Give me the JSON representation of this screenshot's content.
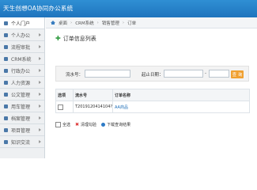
{
  "app": {
    "title": "天生创想OA协同办公系统"
  },
  "sidebar": {
    "items": [
      {
        "label": "个人门户",
        "icon": "home-icon",
        "active": true
      },
      {
        "label": "个人办公",
        "icon": "person-icon"
      },
      {
        "label": "流程审批",
        "icon": "workflow-icon"
      },
      {
        "label": "CRM系统",
        "icon": "crm-icon"
      },
      {
        "label": "行政办公",
        "icon": "admin-icon"
      },
      {
        "label": "人力资源",
        "icon": "people-icon"
      },
      {
        "label": "公文管理",
        "icon": "document-icon"
      },
      {
        "label": "用车管理",
        "icon": "car-icon"
      },
      {
        "label": "档案管理",
        "icon": "archive-icon"
      },
      {
        "label": "项目管理",
        "icon": "project-icon"
      },
      {
        "label": "知识交流",
        "icon": "knowledge-icon"
      }
    ]
  },
  "breadcrumb": {
    "items": [
      "桌面",
      "CRM系统",
      "销售管理",
      "订单"
    ]
  },
  "page": {
    "title": "订单信息列表"
  },
  "search": {
    "order_no_label": "流水号：",
    "order_no_value": "",
    "date_label": "起止日期：",
    "date_from": "",
    "date_sep": "-",
    "date_to": "",
    "button_label": "查 询"
  },
  "table": {
    "headers": [
      "选项",
      "流水号",
      "订单名称"
    ],
    "rows": [
      {
        "no": "T2019120414104?",
        "name": "AA商品"
      }
    ]
  },
  "footer": {
    "select_all": "全选",
    "delete_selected": "清理勾验",
    "download": "下载查询结果"
  },
  "colors": {
    "topbar": "#1f74bd",
    "link": "#1f6fb8",
    "search_button": "#f0a030"
  }
}
